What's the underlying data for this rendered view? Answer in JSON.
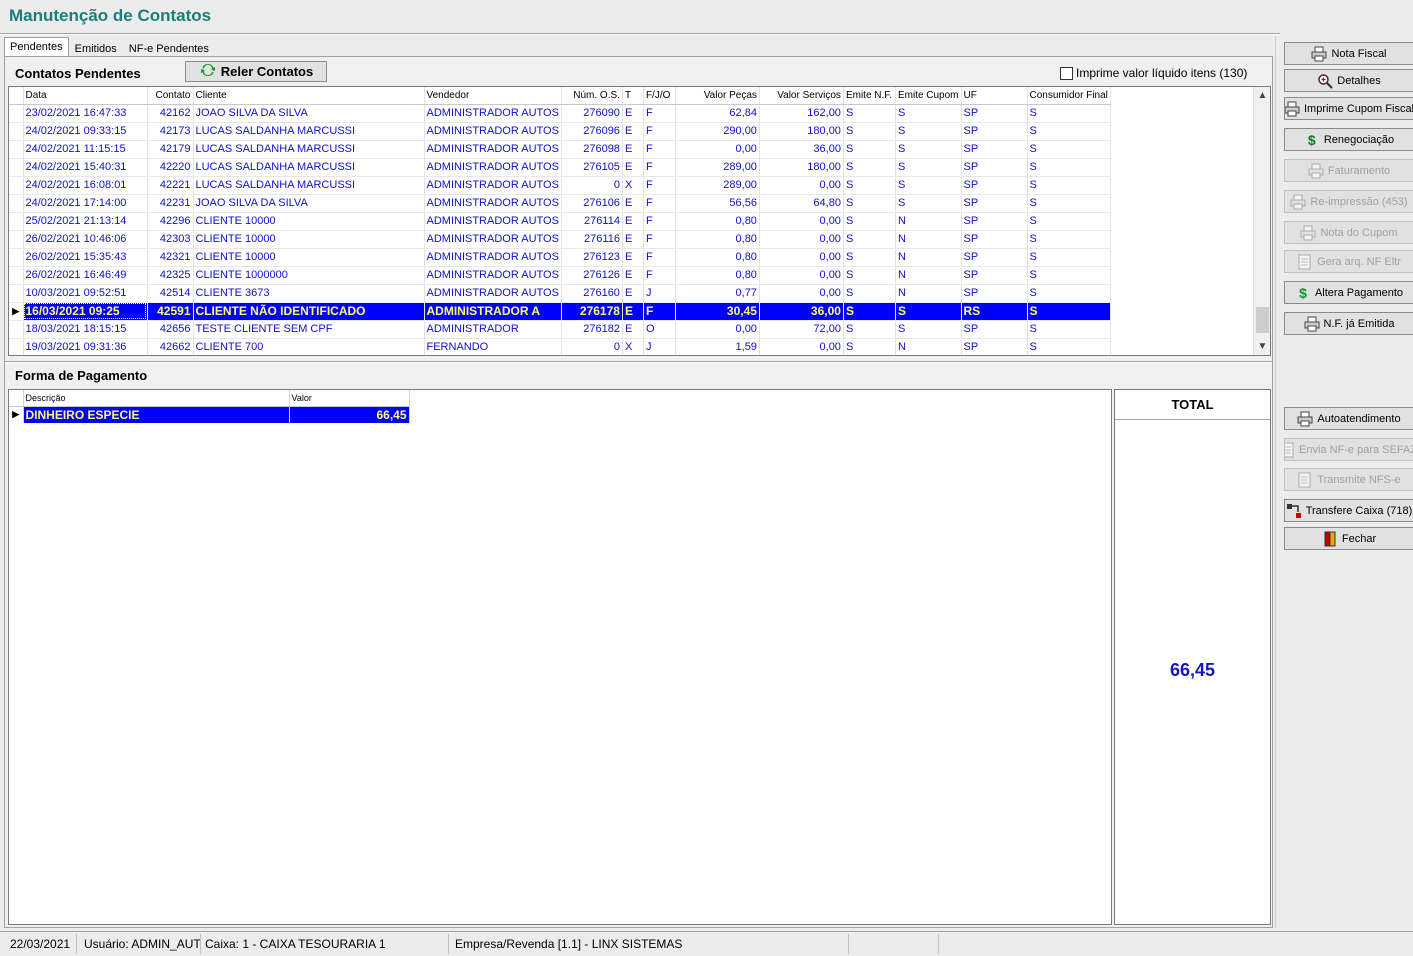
{
  "window": {
    "title": "Manutenção de Contatos"
  },
  "tabs": [
    {
      "label": "Pendentes",
      "active": true
    },
    {
      "label": "Emitidos",
      "active": false
    },
    {
      "label": "NF-e Pendentes",
      "active": false
    }
  ],
  "contacts_section": {
    "title": "Contatos Pendentes",
    "reload_button": "Reler Contatos",
    "checkbox_label": "Imprime valor líquido itens (130)",
    "checkbox_checked": false
  },
  "contacts_table": {
    "columns": [
      "Data",
      "Contato",
      "Cliente",
      "Vendedor",
      "Núm. O.S.",
      "T",
      "F/J/O",
      "Valor Peças",
      "Valor Serviços",
      "Emite N.F.",
      "Emite Cupom",
      "UF",
      "Consumidor Final"
    ],
    "rows": [
      [
        "23/02/2021 16:47:33",
        "42162",
        "JOAO SILVA DA SILVA",
        "ADMINISTRADOR AUTOS",
        "276090",
        "E",
        "F",
        "62,84",
        "162,00",
        "S",
        "S",
        "SP",
        "S"
      ],
      [
        "24/02/2021 09:33:15",
        "42173",
        "LUCAS SALDANHA MARCUSSI",
        "ADMINISTRADOR AUTOS",
        "276096",
        "E",
        "F",
        "290,00",
        "180,00",
        "S",
        "S",
        "SP",
        "S"
      ],
      [
        "24/02/2021 11:15:15",
        "42179",
        "LUCAS SALDANHA MARCUSSI",
        "ADMINISTRADOR AUTOS",
        "276098",
        "E",
        "F",
        "0,00",
        "36,00",
        "S",
        "S",
        "SP",
        "S"
      ],
      [
        "24/02/2021 15:40:31",
        "42220",
        "LUCAS SALDANHA MARCUSSI",
        "ADMINISTRADOR AUTOS",
        "276105",
        "E",
        "F",
        "289,00",
        "180,00",
        "S",
        "S",
        "SP",
        "S"
      ],
      [
        "24/02/2021 16:08:01",
        "42221",
        "LUCAS SALDANHA MARCUSSI",
        "ADMINISTRADOR AUTOS",
        "0",
        "X",
        "F",
        "289,00",
        "0,00",
        "S",
        "S",
        "SP",
        "S"
      ],
      [
        "24/02/2021 17:14:00",
        "42231",
        "JOAO SILVA DA SILVA",
        "ADMINISTRADOR AUTOS",
        "276106",
        "E",
        "F",
        "56,56",
        "64,80",
        "S",
        "S",
        "SP",
        "S"
      ],
      [
        "25/02/2021 21:13:14",
        "42296",
        "CLIENTE  10000",
        "ADMINISTRADOR AUTOS",
        "276114",
        "E",
        "F",
        "0,80",
        "0,00",
        "S",
        "N",
        "SP",
        "S"
      ],
      [
        "26/02/2021 10:46:06",
        "42303",
        "CLIENTE  10000",
        "ADMINISTRADOR AUTOS",
        "276116",
        "E",
        "F",
        "0,80",
        "0,00",
        "S",
        "N",
        "SP",
        "S"
      ],
      [
        "26/02/2021 15:35:43",
        "42321",
        "CLIENTE  10000",
        "ADMINISTRADOR AUTOS",
        "276123",
        "E",
        "F",
        "0,80",
        "0,00",
        "S",
        "N",
        "SP",
        "S"
      ],
      [
        "26/02/2021 16:46:49",
        "42325",
        "CLIENTE  1000000",
        "ADMINISTRADOR AUTOS",
        "276126",
        "E",
        "F",
        "0,80",
        "0,00",
        "S",
        "N",
        "SP",
        "S"
      ],
      [
        "10/03/2021 09:52:51",
        "42514",
        "CLIENTE  3673",
        "ADMINISTRADOR AUTOS",
        "276160",
        "E",
        "J",
        "0,77",
        "0,00",
        "S",
        "N",
        "SP",
        "S"
      ],
      [
        "16/03/2021 09:25",
        "42591",
        "CLIENTE NÃO IDENTIFICADO",
        "ADMINISTRADOR A",
        "276178",
        "E",
        "F",
        "30,45",
        "36,00",
        "S",
        "S",
        "RS",
        "S"
      ],
      [
        "18/03/2021 18:15:15",
        "42656",
        "TESTE CLIENTE SEM CPF",
        "ADMINISTRADOR",
        "276182",
        "E",
        "O",
        "0,00",
        "72,00",
        "S",
        "S",
        "SP",
        "S"
      ],
      [
        "19/03/2021 09:31:36",
        "42662",
        "CLIENTE  700",
        "FERNANDO",
        "0",
        "X",
        "J",
        "1,59",
        "0,00",
        "S",
        "N",
        "SP",
        "S"
      ]
    ],
    "selected_row": 11
  },
  "payment_section": {
    "title": "Forma de Pagamento",
    "columns": [
      "Descrição",
      "Valor"
    ],
    "rows": [
      [
        "DINHEIRO ESPECIE",
        "66,45"
      ]
    ]
  },
  "total": {
    "label": "TOTAL",
    "value": "66,45"
  },
  "sidebar_buttons": [
    {
      "label": "Nota Fiscal",
      "icon": "printer-icon",
      "enabled": true
    },
    {
      "label": "Detalhes",
      "icon": "magnifier-icon",
      "enabled": true
    },
    {
      "label": "Imprime Cupom Fiscal",
      "icon": "printer-icon",
      "enabled": true
    },
    {
      "label": "Renegociação",
      "icon": "dollar-icon",
      "enabled": true
    },
    {
      "label": "Faturamento",
      "icon": "printer-icon",
      "enabled": false
    },
    {
      "label": "Re-impressão (453)",
      "icon": "printer-icon",
      "enabled": false
    },
    {
      "label": "Nota do Cupom",
      "icon": "printer-icon",
      "enabled": false
    },
    {
      "label": "Gera arq. NF Eltr",
      "icon": "document-icon",
      "enabled": false
    },
    {
      "label": "Altera Pagamento",
      "icon": "dollar-icon",
      "enabled": true
    },
    {
      "label": "N.F. já Emitida",
      "icon": "printer-icon",
      "enabled": true
    },
    {
      "label": "Autoatendimento",
      "icon": "printer-icon",
      "enabled": true
    },
    {
      "label": "Envia NF-e para SEFAZ",
      "icon": "document-icon",
      "enabled": false
    },
    {
      "label": "Transmite NFS-e",
      "icon": "document-icon",
      "enabled": false
    },
    {
      "label": "Transfere Caixa (718)",
      "icon": "transfer-icon",
      "enabled": true
    },
    {
      "label": "Fechar",
      "icon": "door-icon",
      "enabled": true
    }
  ],
  "status_bar": {
    "date": "22/03/2021",
    "user": "Usuário: ADMIN_AUTO",
    "caixa": "Caixa: 1 - CAIXA TESOURARIA 1",
    "empresa": "Empresa/Revenda [1.1] - LINX SISTEMAS"
  },
  "colors": {
    "title": "#1b7d7d",
    "row_text": "#1010c8",
    "selection_bg": "#0000ff",
    "selection_text": "#ffff66",
    "total_value": "#1414c8"
  }
}
